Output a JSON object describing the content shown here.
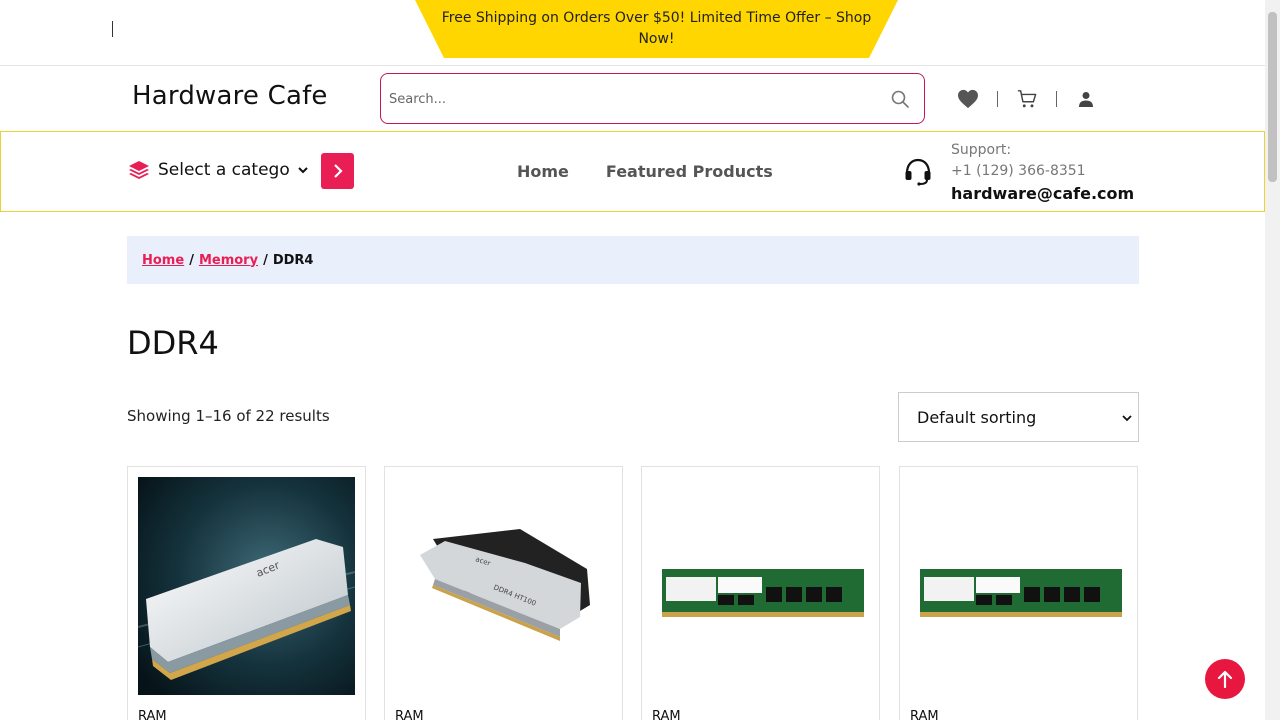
{
  "promo": {
    "text": "Free Shipping on Orders Over $50! Limited Time Offer – Shop Now!"
  },
  "header": {
    "brand": "Hardware Cafe",
    "search_placeholder": "Search...",
    "icons": [
      "heart-icon",
      "cart-icon",
      "user-icon"
    ]
  },
  "navbar": {
    "category_label": "Select a category",
    "links": [
      "Home",
      "Featured Products"
    ],
    "support_label": "Support:",
    "support_phone": "+1 (129) 366-8351",
    "support_email": "hardware@cafe.com"
  },
  "breadcrumb": {
    "home": "Home",
    "memory": "Memory",
    "current": "DDR4",
    "separator": "/"
  },
  "page": {
    "title": "DDR4",
    "result_count": "Showing 1–16 of 22 results",
    "sort_label": "Default sorting"
  },
  "products": [
    {
      "category": "RAM",
      "image": "acer-ddr4-white-hero"
    },
    {
      "category": "RAM",
      "image": "acer-ddr4-white-black-stick"
    },
    {
      "category": "RAM",
      "image": "adata-ddr4-green-stick"
    },
    {
      "category": "RAM",
      "image": "adata-ddr4-green-stick"
    }
  ],
  "colors": {
    "accent": "#e91e55",
    "promo": "#ffd600",
    "nav_border": "#e9d33a",
    "crumb_bg": "#eaf0fb"
  }
}
